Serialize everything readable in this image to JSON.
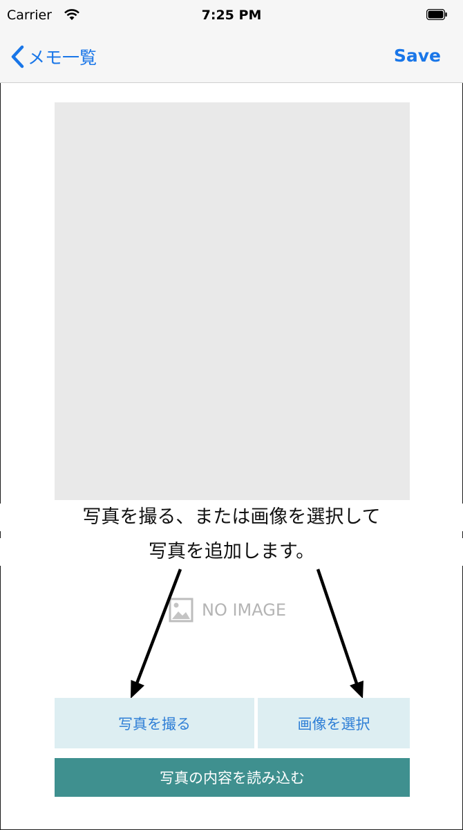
{
  "status_bar": {
    "carrier": "Carrier",
    "time": "7:25 PM"
  },
  "nav": {
    "back_label": "メモ一覧",
    "save_label": "Save"
  },
  "placeholder": {
    "text": "NO IMAGE"
  },
  "instruction": {
    "line1": "写真を撮る、または画像を選択して",
    "line2": "写真を追加します。"
  },
  "buttons": {
    "take_photo": "写真を撮る",
    "select_image": "画像を選択",
    "read_contents": "写真の内容を読み込む"
  },
  "colors": {
    "accent": "#1976e8",
    "button_bg": "#ddeef2",
    "primary_button": "#3f908f",
    "image_bg": "#e9e9e9"
  }
}
